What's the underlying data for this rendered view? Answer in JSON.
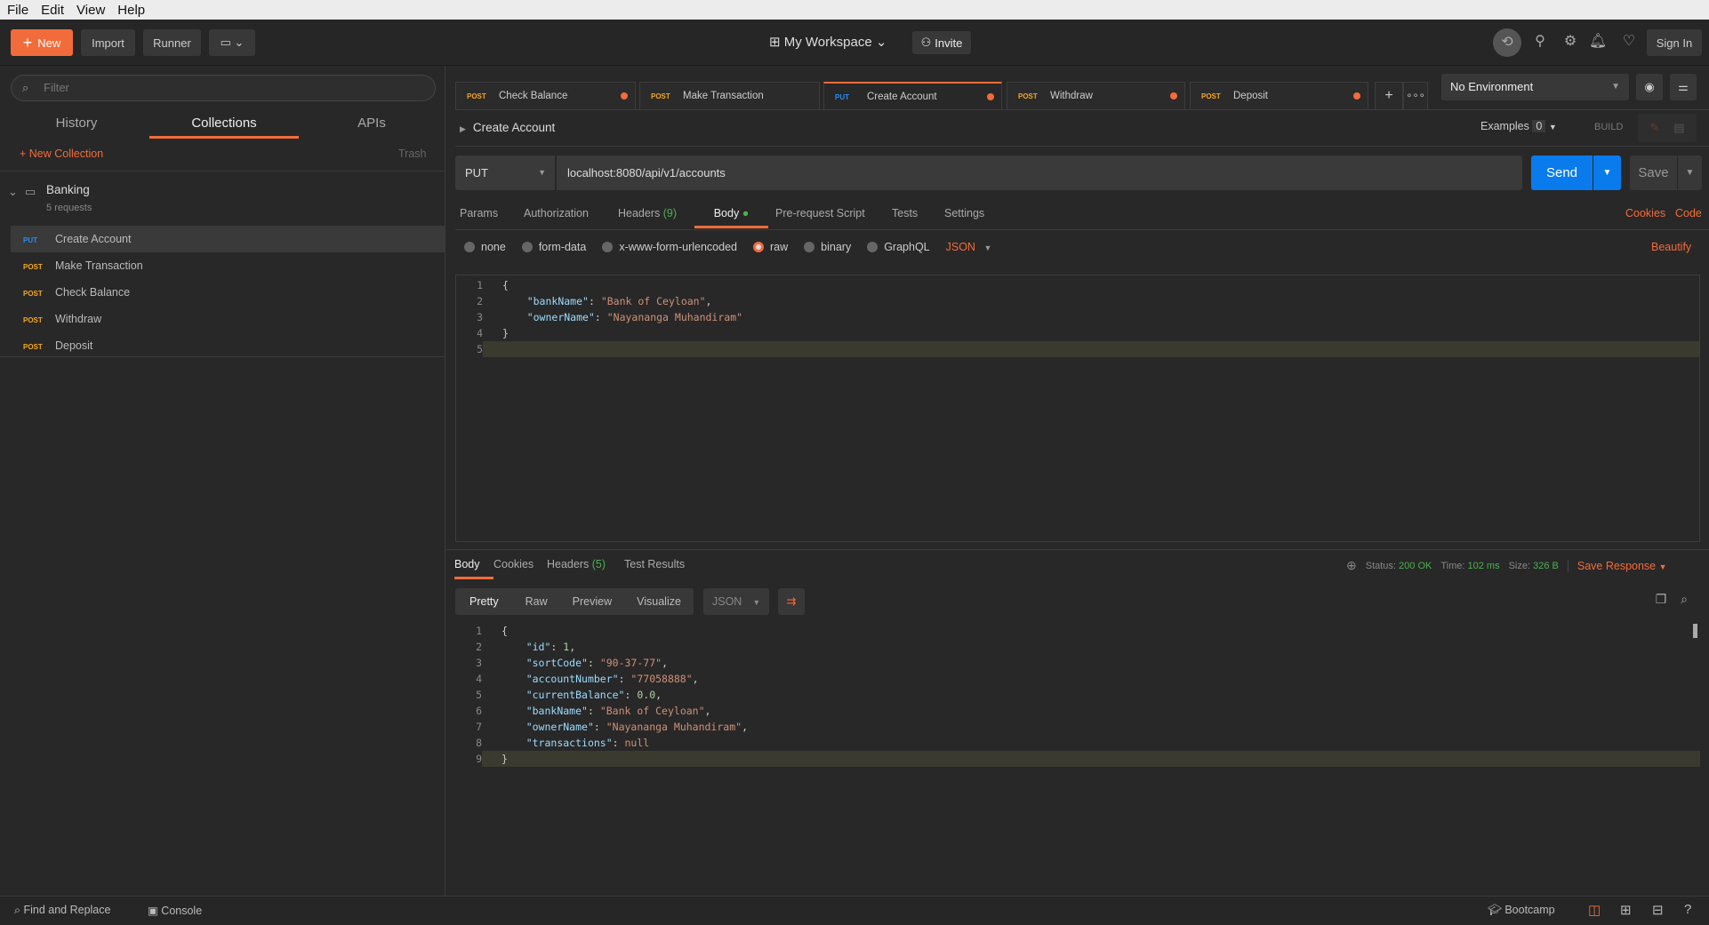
{
  "menu": [
    "File",
    "Edit",
    "View",
    "Help"
  ],
  "toolbar": {
    "new": "New",
    "import": "Import",
    "runner": "Runner",
    "workspace": "My Workspace",
    "invite": "Invite",
    "sign_in": "Sign In"
  },
  "sidebar": {
    "filter_placeholder": "Filter",
    "tabs": [
      "History",
      "Collections",
      "APIs"
    ],
    "new_collection": "+ New Collection",
    "trash": "Trash",
    "collection": {
      "name": "Banking",
      "count": "5 requests"
    },
    "requests": [
      {
        "method": "PUT",
        "name": "Create Account"
      },
      {
        "method": "POST",
        "name": "Make Transaction"
      },
      {
        "method": "POST",
        "name": "Check Balance"
      },
      {
        "method": "POST",
        "name": "Withdraw"
      },
      {
        "method": "POST",
        "name": "Deposit"
      }
    ]
  },
  "tabs": [
    {
      "method": "POST",
      "name": "Check Balance"
    },
    {
      "method": "POST",
      "name": "Make Transaction"
    },
    {
      "method": "PUT",
      "name": "Create Account"
    },
    {
      "method": "POST",
      "name": "Withdraw"
    },
    {
      "method": "POST",
      "name": "Deposit"
    }
  ],
  "environment": "No Environment",
  "request": {
    "title": "Create Account",
    "examples": "Examples",
    "examples_count": "0",
    "build": "BUILD",
    "method": "PUT",
    "url": "localhost:8080/api/v1/accounts",
    "send": "Send",
    "save": "Save",
    "tabs": [
      "Params",
      "Authorization",
      "Headers",
      "Body",
      "Pre-request Script",
      "Tests",
      "Settings"
    ],
    "headers_count": "(9)",
    "cookies": "Cookies",
    "code": "Code",
    "body_types": [
      "none",
      "form-data",
      "x-www-form-urlencoded",
      "raw",
      "binary",
      "GraphQL"
    ],
    "body_format": "JSON",
    "beautify": "Beautify",
    "body_lines": [
      "{",
      "    \"bankName\": \"Bank of Ceyloan\",",
      "    \"ownerName\": \"Nayananga Muhandiram\"",
      "}",
      ""
    ]
  },
  "response": {
    "tabs": [
      "Body",
      "Cookies",
      "Headers",
      "Test Results"
    ],
    "headers_count": "(5)",
    "status_label": "Status:",
    "status": "200 OK",
    "time_label": "Time:",
    "time": "102 ms",
    "size_label": "Size:",
    "size": "326 B",
    "save_response": "Save Response",
    "views": [
      "Pretty",
      "Raw",
      "Preview",
      "Visualize"
    ],
    "format": "JSON",
    "body_lines": [
      "{",
      "    \"id\": 1,",
      "    \"sortCode\": \"90-37-77\",",
      "    \"accountNumber\": \"77058888\",",
      "    \"currentBalance\": 0.0,",
      "    \"bankName\": \"Bank of Ceyloan\",",
      "    \"ownerName\": \"Nayananga Muhandiram\",",
      "    \"transactions\": null",
      "}"
    ]
  },
  "footer": {
    "find_replace": "Find and Replace",
    "console": "Console",
    "bootcamp": "Bootcamp"
  }
}
